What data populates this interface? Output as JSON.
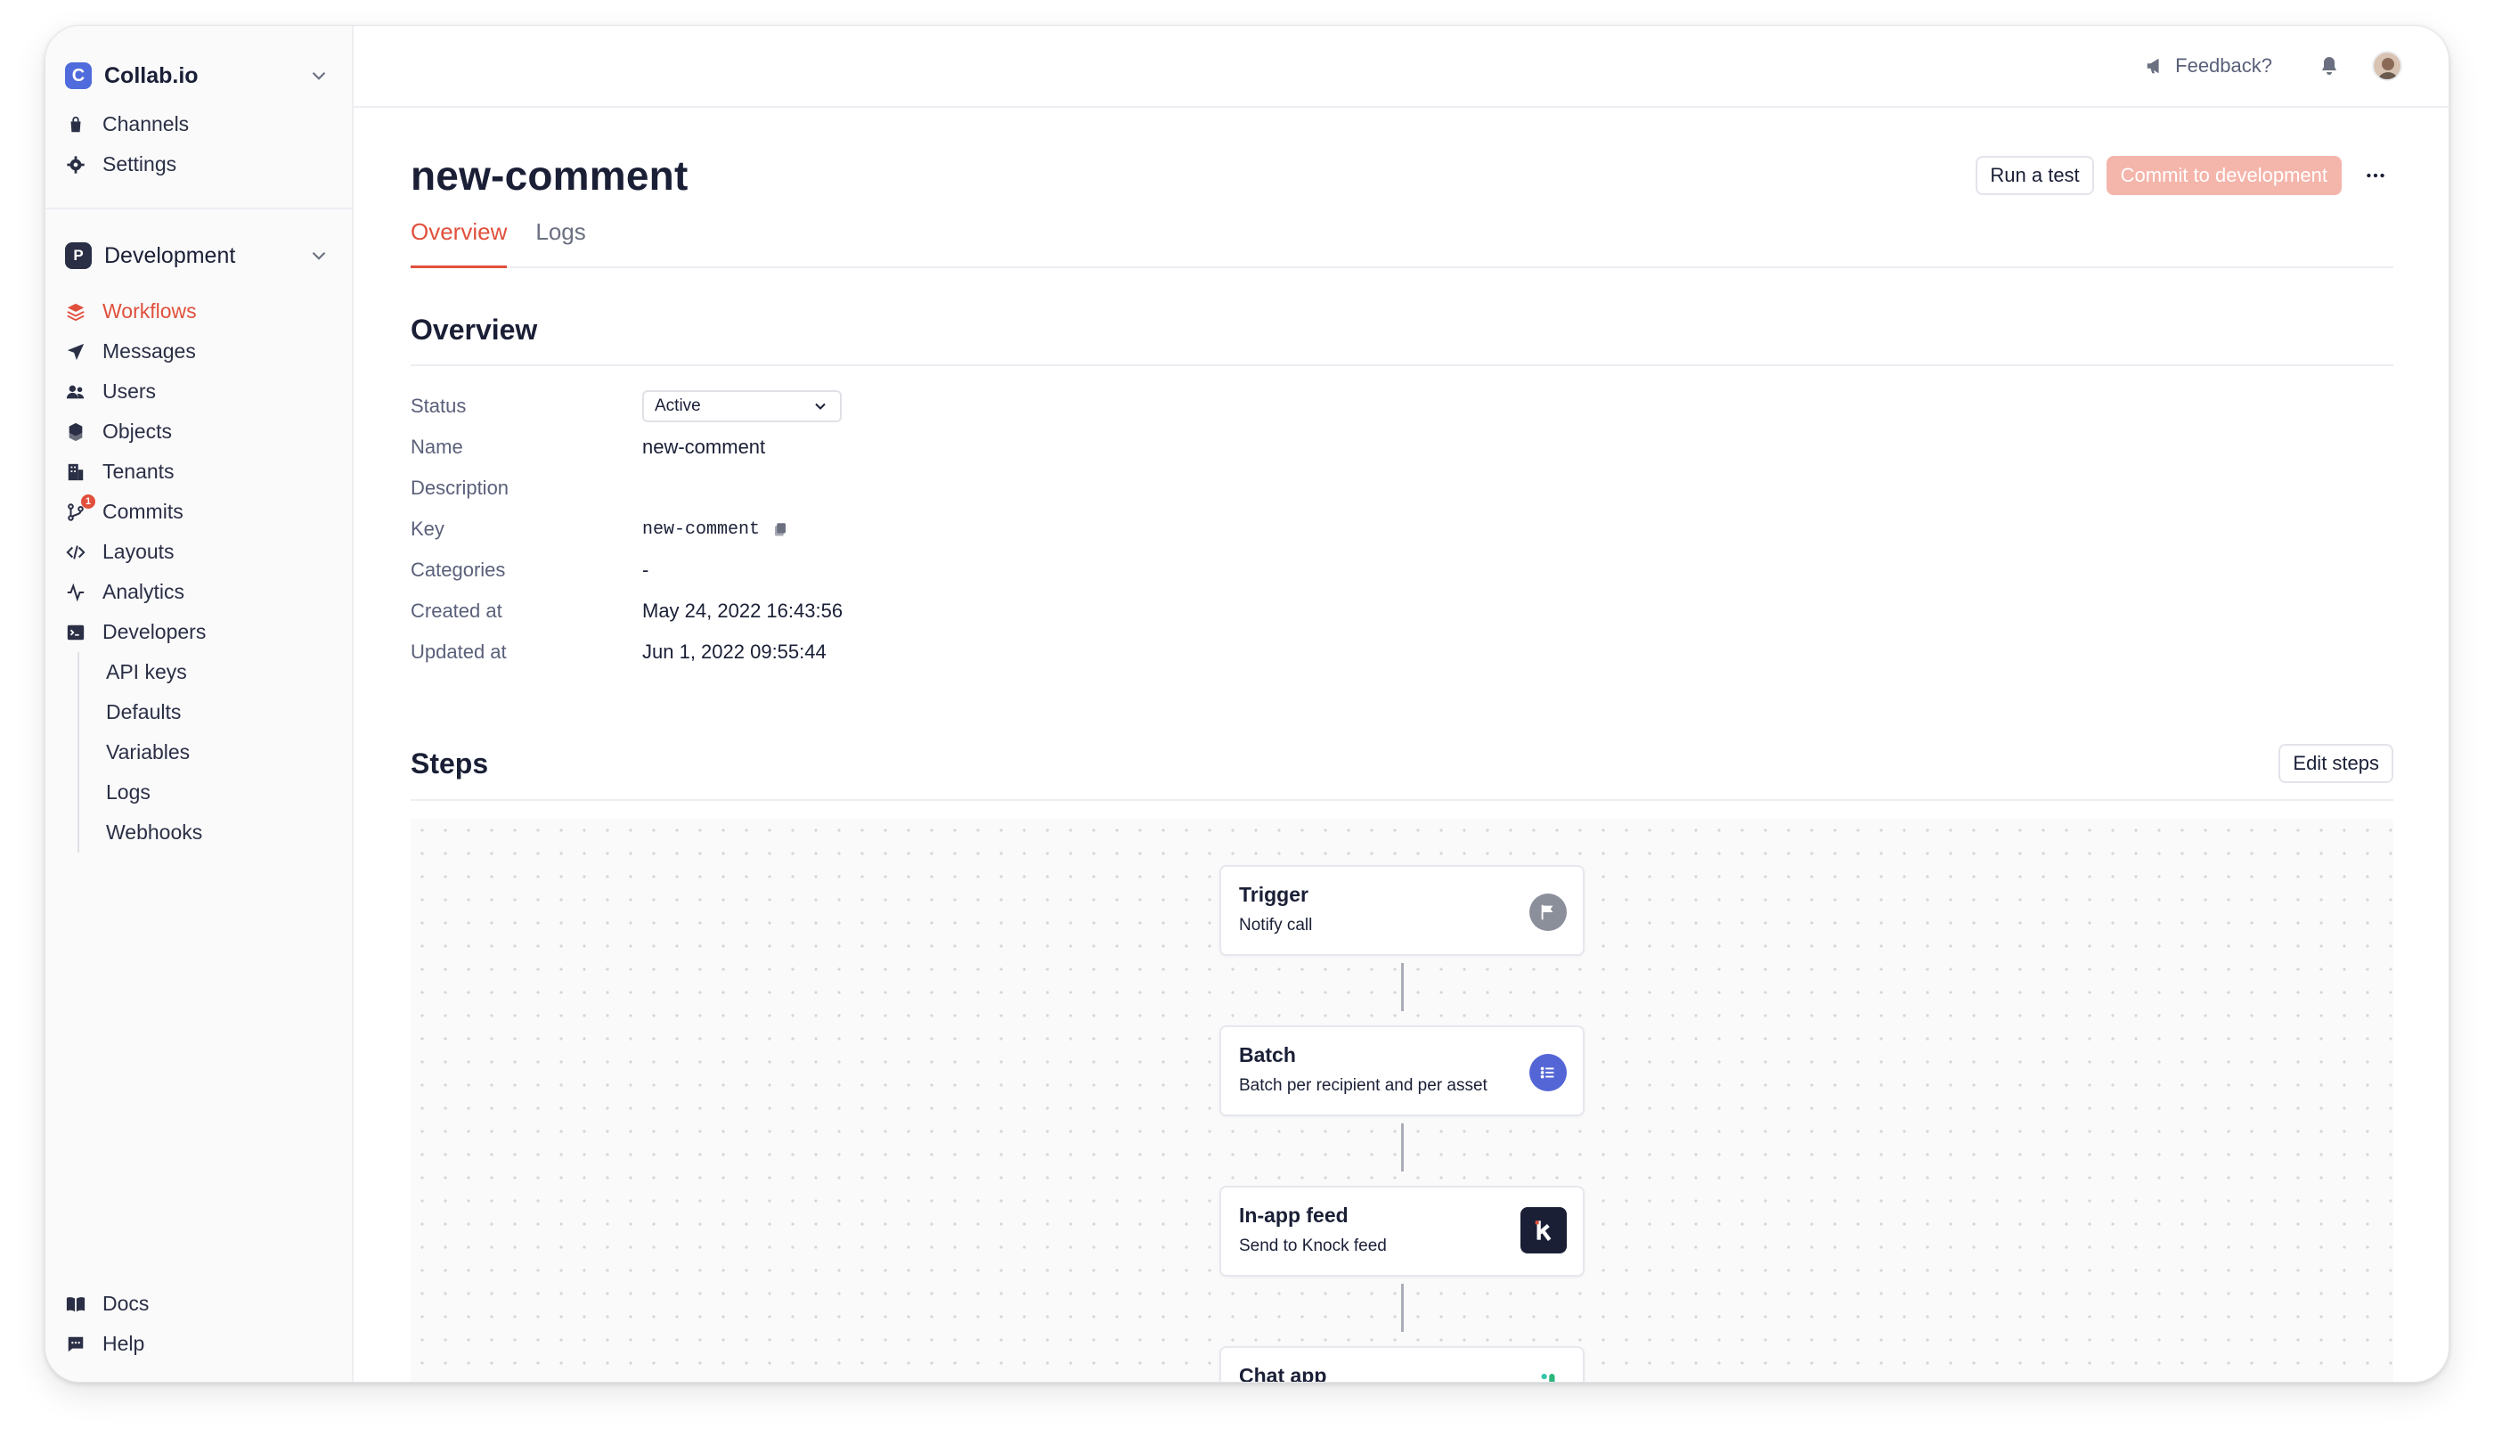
{
  "workspace": {
    "name": "Collab.io",
    "logo_letter": "C"
  },
  "top_nav": [
    {
      "label": "Channels",
      "icon": "bag-icon"
    },
    {
      "label": "Settings",
      "icon": "gear-icon"
    }
  ],
  "environment": {
    "name": "Development",
    "logo_letter": "P"
  },
  "env_nav": [
    {
      "label": "Workflows",
      "icon": "layers-icon",
      "active": true
    },
    {
      "label": "Messages",
      "icon": "paper-plane-icon"
    },
    {
      "label": "Users",
      "icon": "users-icon"
    },
    {
      "label": "Objects",
      "icon": "cubes-icon"
    },
    {
      "label": "Tenants",
      "icon": "building-icon"
    },
    {
      "label": "Commits",
      "icon": "git-branch-icon",
      "badge": "1"
    },
    {
      "label": "Layouts",
      "icon": "code-icon"
    },
    {
      "label": "Analytics",
      "icon": "activity-icon"
    },
    {
      "label": "Developers",
      "icon": "terminal-icon"
    }
  ],
  "developers_subnav": [
    "API keys",
    "Defaults",
    "Variables",
    "Logs",
    "Webhooks"
  ],
  "bottom_nav": [
    {
      "label": "Docs",
      "icon": "book-icon"
    },
    {
      "label": "Help",
      "icon": "chat-icon"
    }
  ],
  "topbar": {
    "feedback_label": "Feedback?"
  },
  "page": {
    "title": "new-comment",
    "run_test_label": "Run a test",
    "commit_label": "Commit to development",
    "tabs": [
      {
        "label": "Overview",
        "active": true
      },
      {
        "label": "Logs",
        "active": false
      }
    ]
  },
  "overview": {
    "heading": "Overview",
    "status_label": "Status",
    "status_value": "Active",
    "name_label": "Name",
    "name_value": "new-comment",
    "description_label": "Description",
    "description_value": "",
    "key_label": "Key",
    "key_value": "new-comment",
    "categories_label": "Categories",
    "categories_value": "-",
    "created_label": "Created at",
    "created_value": "May 24, 2022 16:43:56",
    "updated_label": "Updated at",
    "updated_value": "Jun 1, 2022 09:55:44"
  },
  "steps": {
    "heading": "Steps",
    "edit_label": "Edit steps",
    "items": [
      {
        "title": "Trigger",
        "desc": "Notify call",
        "icon": "flag-icon",
        "color": "#8b8f9a"
      },
      {
        "title": "Batch",
        "desc": "Batch per recipient and per asset",
        "icon": "list-icon",
        "color": "#5466d6"
      },
      {
        "title": "In-app feed",
        "desc": "Send to Knock feed",
        "icon": "knock-logo-icon",
        "color": "#1a1f36"
      },
      {
        "title": "Chat app",
        "desc": "",
        "icon": "slack-icon",
        "color": "#36c5ab"
      }
    ]
  },
  "colors": {
    "accent": "#e0503c",
    "primary_disabled": "#f4b5ab"
  }
}
